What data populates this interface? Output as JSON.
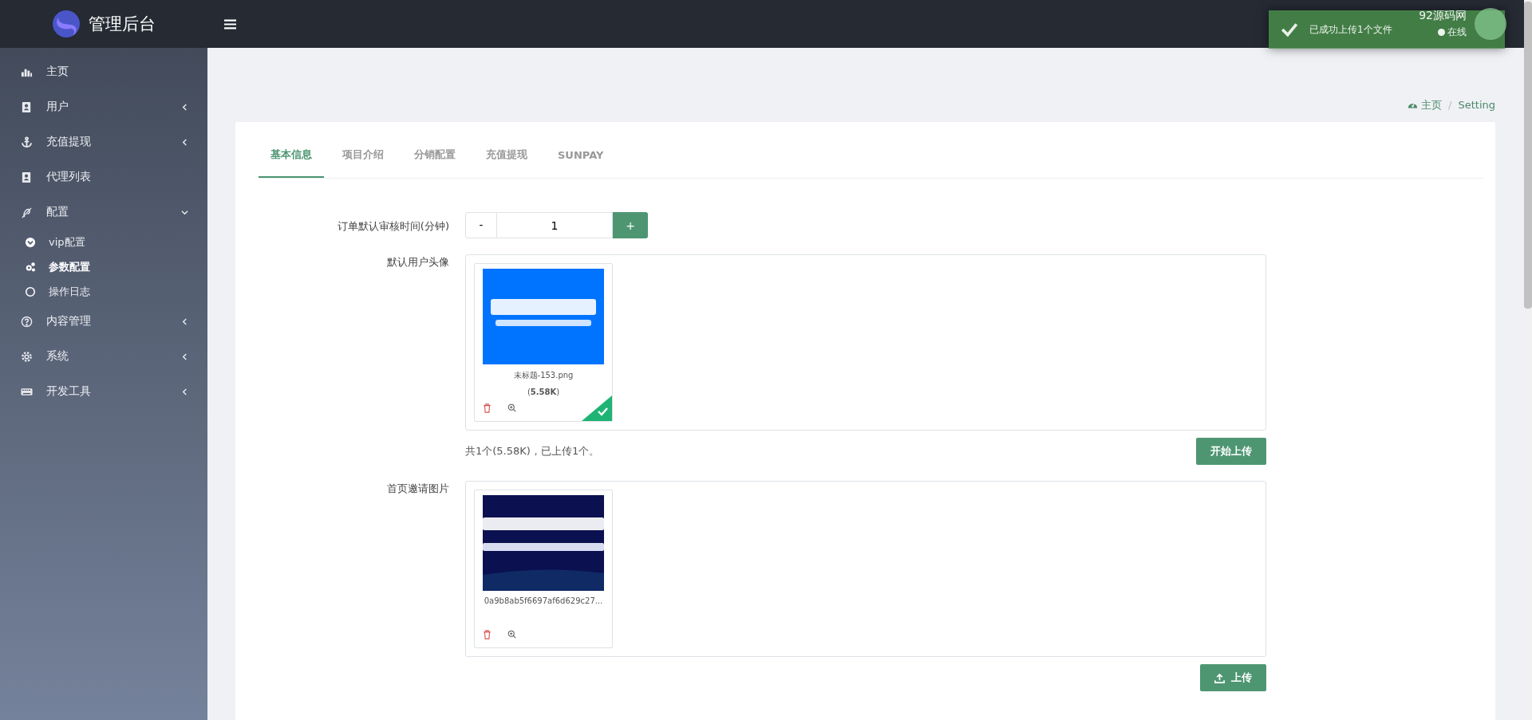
{
  "brand": {
    "title": "管理后台"
  },
  "sidebar": {
    "items": [
      {
        "label": "主页",
        "kind": "link",
        "selected": false
      },
      {
        "label": "用户",
        "kind": "menu",
        "expanded": false,
        "selected": false
      },
      {
        "label": "充值提现",
        "kind": "menu",
        "expanded": false,
        "selected": false
      },
      {
        "label": "代理列表",
        "kind": "link",
        "selected": false
      },
      {
        "label": "配置",
        "kind": "menu",
        "expanded": true,
        "selected": false,
        "children": [
          {
            "label": "vip配置",
            "selected": false
          },
          {
            "label": "参数配置",
            "selected": true
          },
          {
            "label": "操作日志",
            "selected": false
          }
        ]
      },
      {
        "label": "内容管理",
        "kind": "menu",
        "expanded": false,
        "selected": false
      },
      {
        "label": "系统",
        "kind": "menu",
        "expanded": false,
        "selected": false
      },
      {
        "label": "开发工具",
        "kind": "menu",
        "expanded": false,
        "selected": false
      }
    ]
  },
  "user": {
    "name": "92源码网",
    "status": "在线"
  },
  "toast": {
    "message": "已成功上传1个文件"
  },
  "breadcrumb": {
    "separator": "/",
    "items": [
      {
        "label": "主页"
      },
      {
        "label": "Setting"
      }
    ]
  },
  "tabs": [
    {
      "label": "基本信息",
      "selected": true
    },
    {
      "label": "项目介绍",
      "selected": false
    },
    {
      "label": "分销配置",
      "selected": false
    },
    {
      "label": "充值提现",
      "selected": false
    },
    {
      "label": "SUNPAY",
      "selected": false
    }
  ],
  "form": {
    "review_time": {
      "label": "订单默认审核时间(分钟)",
      "minus": "-",
      "value": "1",
      "plus": "+"
    },
    "uploads": [
      {
        "label": "默认用户头像",
        "files": [
          {
            "kind": "picture",
            "name": "未标题-153.png",
            "size": "(**5.58K**)",
            "uploaded": true
          }
        ],
        "summary": "共1个(5.58K)，已上传1个。",
        "button": "开始上传",
        "button_icon": false
      },
      {
        "label": "首页邀请图片",
        "files": [
          {
            "kind": "picture",
            "name": "0a9b8ab5f6697af6d629c27...",
            "uploaded": false
          }
        ],
        "button": "上传",
        "button_icon": true
      }
    ]
  }
}
